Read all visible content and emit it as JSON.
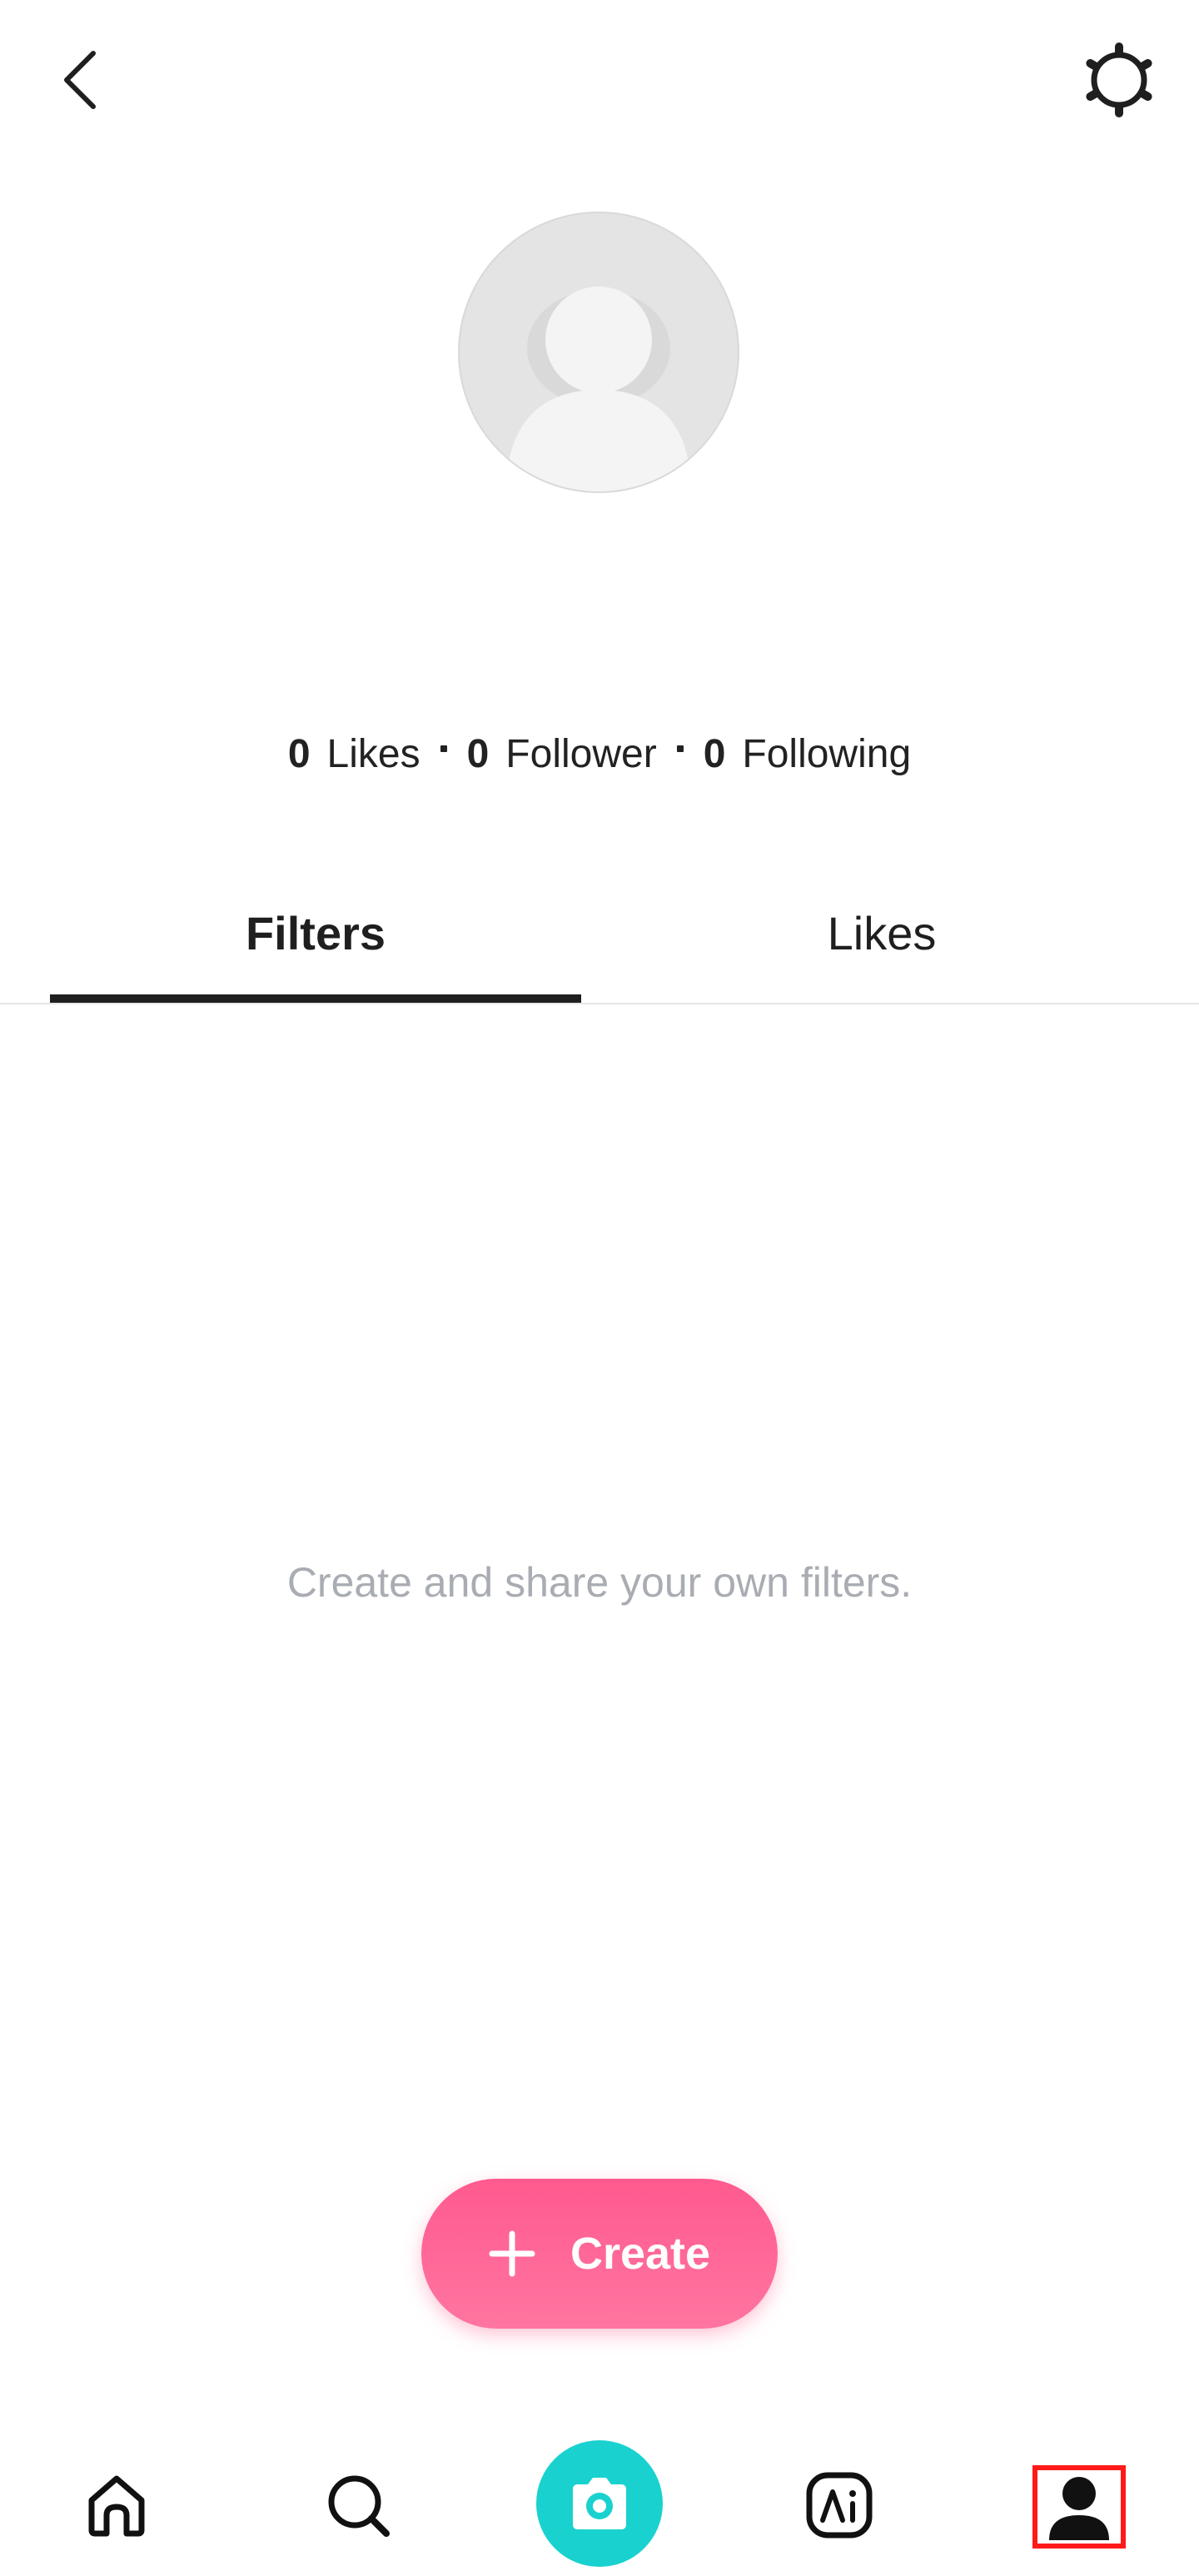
{
  "header": {
    "back_icon": "chevron-left-icon",
    "settings_icon": "gear-icon"
  },
  "profile": {
    "avatar_icon": "default-avatar-icon",
    "stats": {
      "likes_count": "0",
      "likes_label": "Likes",
      "followers_count": "0",
      "followers_label": "Follower",
      "following_count": "0",
      "following_label": "Following"
    }
  },
  "tabs": [
    {
      "label": "Filters",
      "selected": true
    },
    {
      "label": "Likes",
      "selected": false
    }
  ],
  "empty_state": {
    "message": "Create and share your own filters."
  },
  "create_button": {
    "label": "Create",
    "icon": "plus-icon",
    "color": "#ff5c8f"
  },
  "bottom_nav": {
    "items": [
      {
        "name": "home",
        "icon": "home-icon"
      },
      {
        "name": "search",
        "icon": "search-icon"
      },
      {
        "name": "camera",
        "icon": "camera-icon",
        "color": "#19d2cf"
      },
      {
        "name": "ai",
        "icon": "ai-icon"
      },
      {
        "name": "profile",
        "icon": "person-icon",
        "selected": true
      }
    ]
  },
  "colors": {
    "accent_teal": "#19d2cf",
    "accent_pink": "#ff5c8f",
    "text_primary": "#1f1f1f",
    "text_muted": "#a9adb3",
    "highlight_box": "#ff1a1a"
  }
}
